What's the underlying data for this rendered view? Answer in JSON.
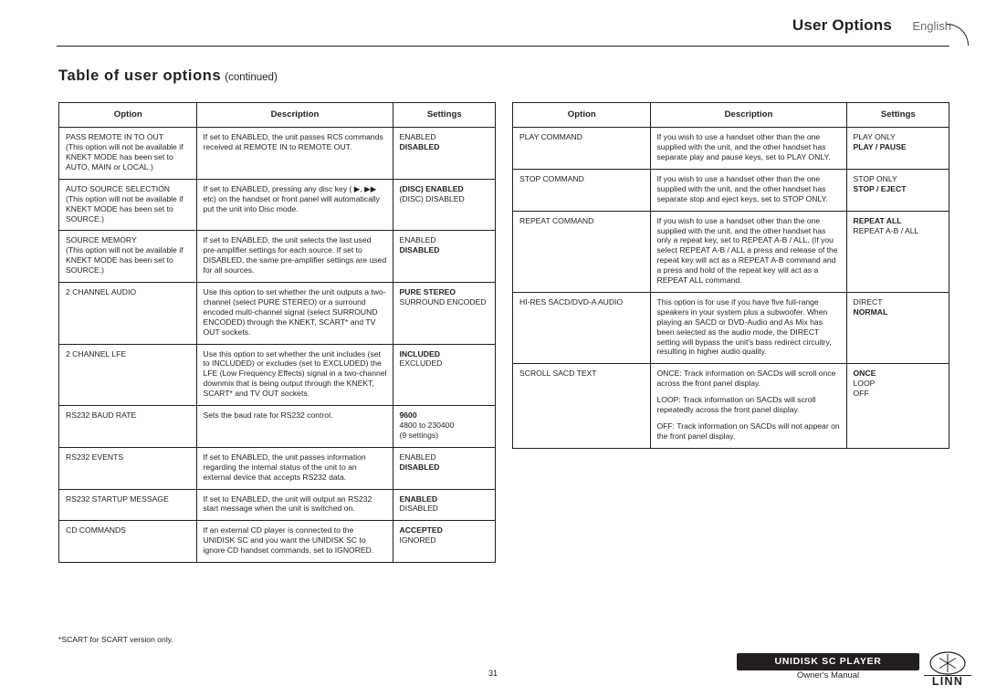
{
  "header": {
    "title": "User Options",
    "language": "English"
  },
  "section": {
    "title": "Table of user options",
    "subtitle": "(continued)"
  },
  "columns": {
    "option": "Option",
    "description": "Description",
    "settings": "Settings"
  },
  "left_table": [
    {
      "option": "PASS REMOTE IN TO OUT",
      "option_note": "(This option will not be available if KNEKT MODE has been set to AUTO, MAIN or LOCAL.)",
      "description": "If set to ENABLED, the unit passes RC5 commands received at REMOTE IN to REMOTE OUT.",
      "settings": [
        {
          "text": "ENABLED",
          "bold": false
        },
        {
          "text": "DISABLED",
          "bold": true
        }
      ]
    },
    {
      "option": "AUTO SOURCE SELECTION",
      "option_note": "(This option will not be available if KNEKT MODE has been set to SOURCE.)",
      "description": "If set to ENABLED, pressing any disc key ( ▶, ▶▶ etc) on the handset or front panel will automatically put the unit into Disc mode.",
      "settings": [
        {
          "text": "(DISC) ENABLED",
          "bold": true
        },
        {
          "text": "(DISC) DISABLED",
          "bold": false
        }
      ]
    },
    {
      "option": "SOURCE MEMORY",
      "option_note": "(This option will not be available if KNEKT MODE has been set to SOURCE.)",
      "description": "If set to ENABLED, the unit selects the last used pre-amplifier settings for each source. If set to DISABLED, the same pre-amplifier settings are used for all sources.",
      "settings": [
        {
          "text": "ENABLED",
          "bold": false
        },
        {
          "text": "DISABLED",
          "bold": true
        }
      ]
    },
    {
      "option": "2 CHANNEL AUDIO",
      "option_note": "",
      "description": "Use this option to set whether the unit outputs a two-channel (select PURE STEREO) or a surround encoded multi-channel signal (select SURROUND ENCODED) through the KNEKT, SCART* and TV OUT sockets.",
      "settings": [
        {
          "text": "PURE STEREO",
          "bold": true
        },
        {
          "text": "SURROUND ENCODED",
          "bold": false
        }
      ]
    },
    {
      "option": "2 CHANNEL LFE",
      "option_note": "",
      "description": "Use this option to set whether the unit includes (set to INCLUDED) or excludes (set to EXCLUDED) the LFE (Low Frequency Effects) signal in a two-channel downmix that is being output through the KNEKT, SCART* and TV OUT sockets.",
      "settings": [
        {
          "text": "INCLUDED",
          "bold": true
        },
        {
          "text": "EXCLUDED",
          "bold": false
        }
      ]
    },
    {
      "option": "RS232 BAUD RATE",
      "option_note": "",
      "description": "Sets the baud rate for RS232 control.",
      "settings": [
        {
          "text": "9600",
          "bold": true
        },
        {
          "text": "4800 to 230400",
          "bold": false
        },
        {
          "text": "(9 settings)",
          "bold": false
        }
      ]
    },
    {
      "option": "RS232 EVENTS",
      "option_note": "",
      "description": "If set to ENABLED, the unit passes information regarding the internal status of the unit to an external device that accepts RS232 data.",
      "settings": [
        {
          "text": "ENABLED",
          "bold": false
        },
        {
          "text": "DISABLED",
          "bold": true
        }
      ]
    },
    {
      "option": "RS232 STARTUP MESSAGE",
      "option_note": "",
      "description": "If set to ENABLED, the unit will output an RS232 start message when the unit is switched on.",
      "settings": [
        {
          "text": "ENABLED",
          "bold": true
        },
        {
          "text": "DISABLED",
          "bold": false
        }
      ]
    },
    {
      "option": "CD COMMANDS",
      "option_note": "",
      "description": "If an external CD player is connected to the UNIDISK SC and you want the UNIDISK SC to ignore CD handset commands, set to IGNORED.",
      "settings": [
        {
          "text": "ACCEPTED",
          "bold": true
        },
        {
          "text": "IGNORED",
          "bold": false
        }
      ]
    }
  ],
  "right_table": [
    {
      "option": "PLAY COMMAND",
      "option_note": "",
      "description": "If you wish to use a handset other than the one supplied with the unit, and the other handset has separate play and pause keys, set to PLAY ONLY.",
      "settings": [
        {
          "text": "PLAY ONLY",
          "bold": false
        },
        {
          "text": "PLAY / PAUSE",
          "bold": true
        }
      ]
    },
    {
      "option": "STOP COMMAND",
      "option_note": "",
      "description": "If you wish to use a handset other than the one supplied with the unit, and the other handset has separate stop and eject keys, set to STOP ONLY.",
      "settings": [
        {
          "text": "STOP ONLY",
          "bold": false
        },
        {
          "text": "STOP / EJECT",
          "bold": true
        }
      ]
    },
    {
      "option": "REPEAT COMMAND",
      "option_note": "",
      "description": "If you wish to use a handset other than the one supplied with the unit, and the other handset has only a repeat key, set to REPEAT A-B / ALL. (If you select REPEAT A-B / ALL a press and release of the repeat key will act as a REPEAT A-B command and a press and hold of the repeat key will act as a REPEAT ALL command.",
      "settings": [
        {
          "text": "REPEAT ALL",
          "bold": true
        },
        {
          "text": "REPEAT A-B / ALL",
          "bold": false
        }
      ]
    },
    {
      "option": "HI-RES SACD/DVD-A AUDIO",
      "option_note": "",
      "description": "This option is for use if you have five full-range speakers in your system plus a subwoofer. When playing an SACD or DVD-Audio and As Mix has been selected as the audio mode, the DIRECT setting will bypass the unit's bass redirect circuitry, resulting in higher audio quality.",
      "settings": [
        {
          "text": "DIRECT",
          "bold": false
        },
        {
          "text": "NORMAL",
          "bold": true
        }
      ]
    },
    {
      "option": "SCROLL SACD TEXT",
      "option_note": "",
      "description": "ONCE: Track information on SACDs will scroll once across the front panel display.\nLOOP: Track information on SACDs will scroll repeatedly across the front panel display.\nOFF: Track information on SACDs will not appear on the front panel display.",
      "settings": [
        {
          "text": "ONCE",
          "bold": true
        },
        {
          "text": "LOOP",
          "bold": false
        },
        {
          "text": "OFF",
          "bold": false
        }
      ]
    }
  ],
  "footnote": "*SCART for SCART version only.",
  "footer": {
    "page_number": "31",
    "product": "UNIDISK SC PLAYER",
    "manual": "Owner's Manual",
    "brand": "LINN"
  }
}
